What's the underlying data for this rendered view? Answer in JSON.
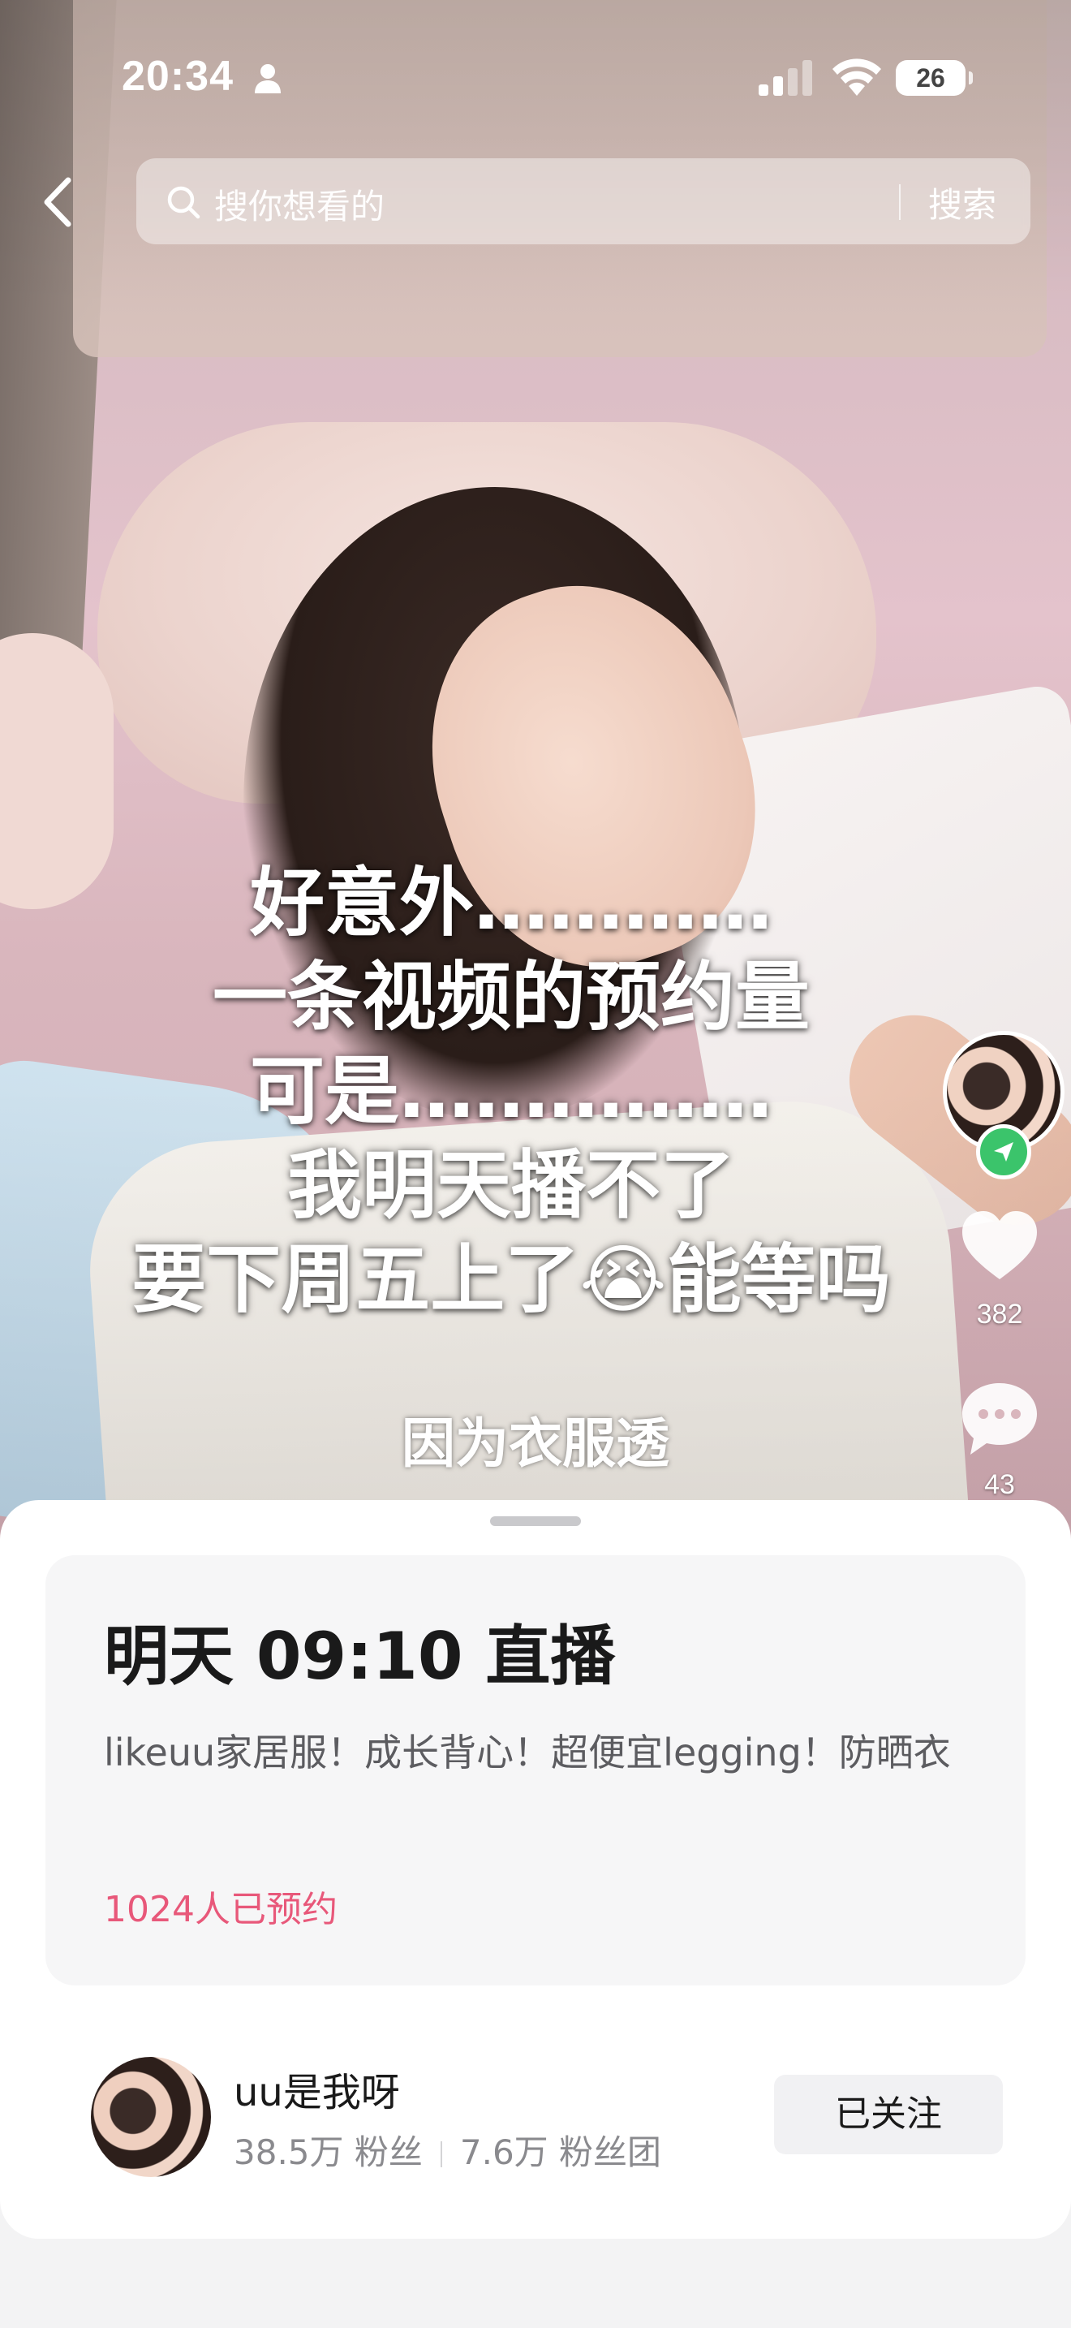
{
  "status_bar": {
    "time": "20:34",
    "battery": "26",
    "icons": [
      "person-icon",
      "signal-icon",
      "wifi-icon",
      "battery-icon"
    ]
  },
  "header": {
    "back_icon": "chevron-left-icon",
    "search_placeholder": "搜你想看的",
    "search_button": "搜索",
    "search_icon": "search-icon"
  },
  "video": {
    "caption_lines": [
      "好意外…………",
      "一条视频的预约量",
      "可是……………",
      "我明天播不了",
      "要下周五上了😭能等吗"
    ],
    "subtitle": "因为衣服透"
  },
  "rail": {
    "like_count": "382",
    "comment_count": "43",
    "colors": {
      "badge": "#3bc46b"
    }
  },
  "live_card": {
    "title": "明天 09:10 直播",
    "description": "likeuu家居服！成长背心！超便宜legging！防晒衣",
    "reservation_count": "1024人已预约"
  },
  "profile": {
    "name": "uu是我呀",
    "followers": "38.5万 粉丝",
    "fan_club": "7.6万 粉丝团",
    "follow_label": "已关注"
  },
  "colors": {
    "accent_pink": "#e8587a",
    "sheet_bg": "#ffffff",
    "card_bg": "#f6f6f7"
  }
}
